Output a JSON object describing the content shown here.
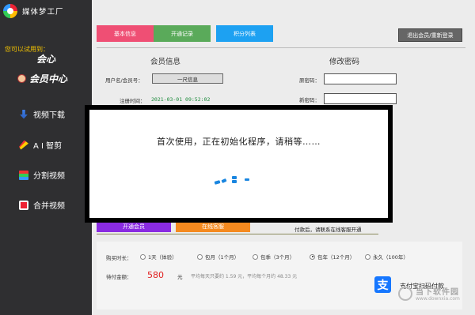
{
  "app": {
    "title": "媒体梦工厂"
  },
  "sidebar": {
    "try_text": "您可以试用到：",
    "brand_xin": "会心",
    "brand_member": "会员中心",
    "items": [
      {
        "label": "视频下载",
        "icon": "download-arrow-icon"
      },
      {
        "label": "A I 智剪",
        "icon": "ai-cut-icon"
      },
      {
        "label": "分割视频",
        "icon": "split-video-icon"
      },
      {
        "label": "合并视频",
        "icon": "merge-video-icon"
      }
    ]
  },
  "tabs": {
    "basic": "基本信息",
    "records": "开通记录",
    "points": "积分列表",
    "logout": "退出会员/重新登录"
  },
  "member_info": {
    "title": "会员信息",
    "username_label": "用户名/会员号：",
    "username_value": "一尺信息",
    "reg_time_label": "注册时间：",
    "reg_time_value": "2021-03-01 09:52:02"
  },
  "change_password": {
    "title": "修改密码",
    "old_label": "原密码：",
    "new_label": "新密码："
  },
  "actions": {
    "open_member": "开通会员",
    "online_service": "在线客服",
    "after_pay": "付款后，请联系在线客服开通"
  },
  "purchase": {
    "duration_label": "购买时长：",
    "options": [
      {
        "label": "1天（体验）",
        "checked": false
      },
      {
        "label": "包月（1个月）",
        "checked": false
      },
      {
        "label": "包季（3个月）",
        "checked": false
      },
      {
        "label": "包年（12个月）",
        "checked": true
      },
      {
        "label": "永久（100年）",
        "checked": false
      }
    ],
    "amount_label": "待付金额：",
    "amount": "580",
    "currency": "元",
    "avg_text": "平均每天只要约 1.59 元，平均每个月约 48.33 元",
    "alipay_glyph": "支",
    "alipay_label": "支付宝扫码付款"
  },
  "modal": {
    "message": "首次使用，正在初始化程序，请稍等……"
  },
  "watermark": {
    "cn": "当下软件园",
    "en": "www.downxia.com"
  },
  "colors": {
    "sidebar_bg": "#2f2f31",
    "tab_basic": "#ef4f74",
    "tab_records": "#5aaa5a",
    "tab_points": "#1da1f2",
    "open_member": "#8a2be2",
    "online_service": "#f58a1f",
    "price": "#e02020",
    "spinner": "#1a86e0"
  }
}
